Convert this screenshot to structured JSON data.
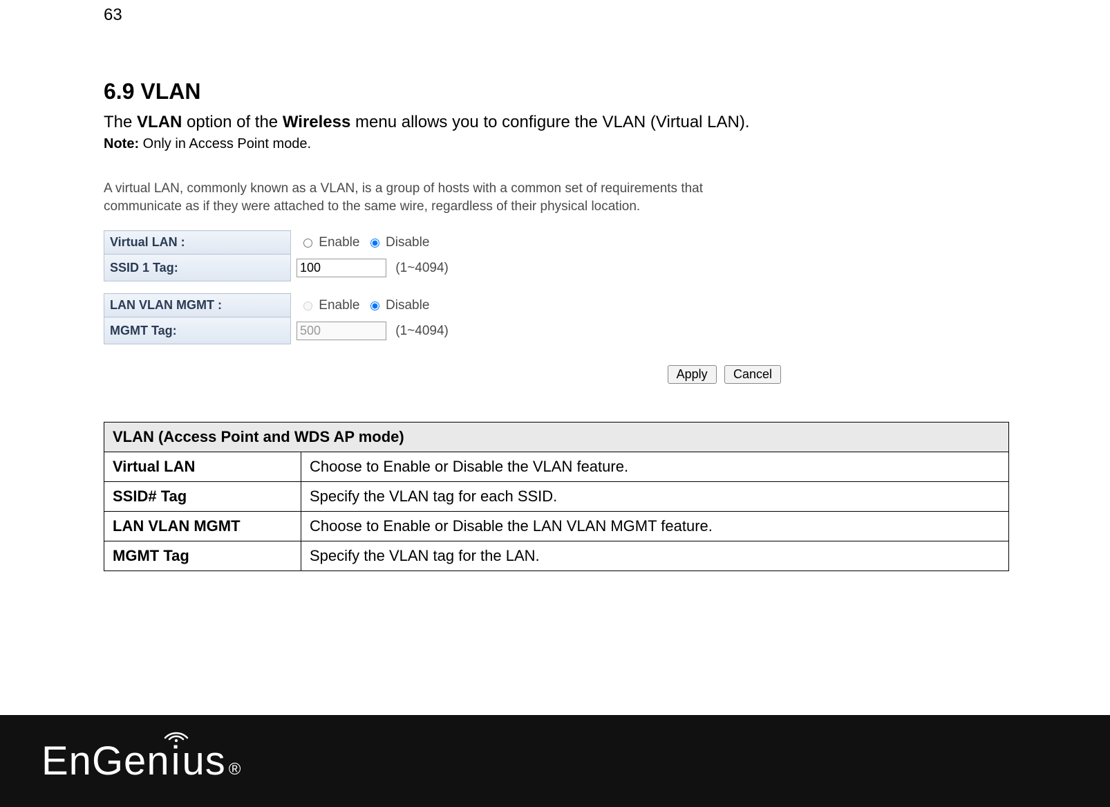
{
  "page_number": "63",
  "heading": "6.9   VLAN",
  "intro_pre": "The ",
  "intro_b1": "VLAN",
  "intro_mid": " option of the ",
  "intro_b2": "Wireless",
  "intro_post": " menu allows you to configure the VLAN (Virtual LAN).",
  "note_label": "Note:",
  "note_text": " Only in Access Point mode.",
  "shot": {
    "desc": "A virtual LAN, commonly known as a VLAN, is a group of hosts with a common set of requirements that communicate as if they were attached to the same wire, regardless of their physical location.",
    "row1_label": "Virtual LAN :",
    "row2_label": "SSID 1 Tag:",
    "row3_label": "LAN VLAN MGMT :",
    "row4_label": "MGMT Tag:",
    "enable": "Enable",
    "disable": "Disable",
    "ssid1_value": "100",
    "mgmt_value": "500",
    "range": "(1~4094)",
    "apply": "Apply",
    "cancel": "Cancel"
  },
  "table": {
    "title": "VLAN (Access Point and WDS AP mode)",
    "rows": [
      {
        "k": "Virtual LAN",
        "v": "Choose to Enable or Disable the VLAN feature."
      },
      {
        "k": "SSID# Tag",
        "v": "Specify the VLAN tag for each SSID."
      },
      {
        "k": "LAN VLAN MGMT",
        "v": "Choose to Enable or Disable the LAN VLAN MGMT feature."
      },
      {
        "k": "MGMT Tag",
        "v": "Specify the VLAN tag for the LAN."
      }
    ]
  },
  "logo_text_1": "EnGen",
  "logo_text_2": "i",
  "logo_text_3": "us",
  "logo_reg": "®"
}
